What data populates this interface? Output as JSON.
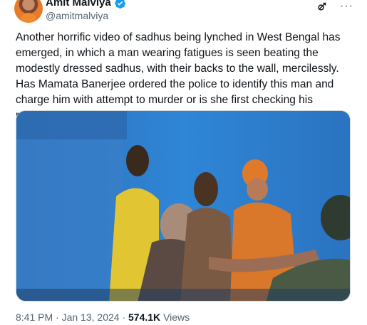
{
  "author": {
    "display_name": "Amit Malviya",
    "handle": "@amitmalviya",
    "verified_icon": "verified-badge-icon",
    "badge_color": "#1d9bf0"
  },
  "header_actions": {
    "grok_icon": "grok-icon",
    "more_label": "···"
  },
  "tweet": {
    "text": "Another horrific video of sadhus being lynched in West Bengal has emerged, in which a man wearing fatigues is seen beating the modestly dressed sadhus, with their backs to the wall, mercilessly. Has Mamata Banerjee ordered the police to identify this man and charge him with attempt to murder or is she first checking his religion?"
  },
  "media": {
    "kind": "video-still",
    "scene_colors": {
      "wall": "#2a7bd0",
      "saffron": "#d9772a"
    }
  },
  "meta": {
    "time": "8:41 PM",
    "sep1": "·",
    "date": "Jan 13, 2024",
    "sep2": "·",
    "views_count": "574.1K",
    "views_label": "Views"
  }
}
